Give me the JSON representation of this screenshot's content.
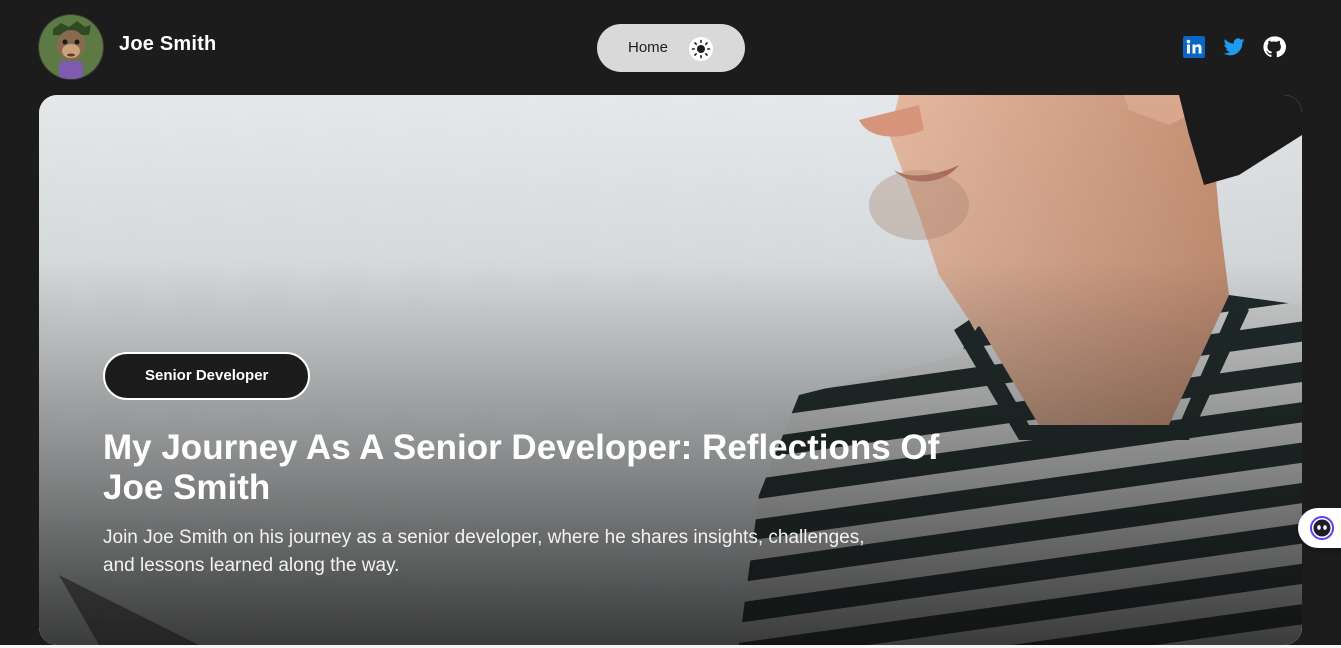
{
  "header": {
    "site_name": "Joe Smith",
    "avatar_icon": "ape-avatar-icon",
    "nav": {
      "home_label": "Home",
      "theme_icon": "sun-icon"
    },
    "social": [
      {
        "name": "LinkedIn",
        "icon": "linkedin-icon",
        "color": "#0a66c2"
      },
      {
        "name": "Twitter",
        "icon": "twitter-icon",
        "color": "#1d9bf0"
      },
      {
        "name": "GitHub",
        "icon": "github-icon",
        "color": "#ffffff"
      }
    ]
  },
  "hero": {
    "tag": "Senior Developer",
    "title": "My Journey As A Senior Developer: Reflections Of Joe Smith",
    "description": "Join Joe Smith on his journey as a senior developer, where he shares insights, challenges, and lessons learned along the way."
  },
  "widget": {
    "icon": "chat-assistant-icon"
  },
  "colors": {
    "background": "#1c1c1c",
    "nav_pill": "#d9d9d9",
    "text_light": "#ffffff"
  }
}
